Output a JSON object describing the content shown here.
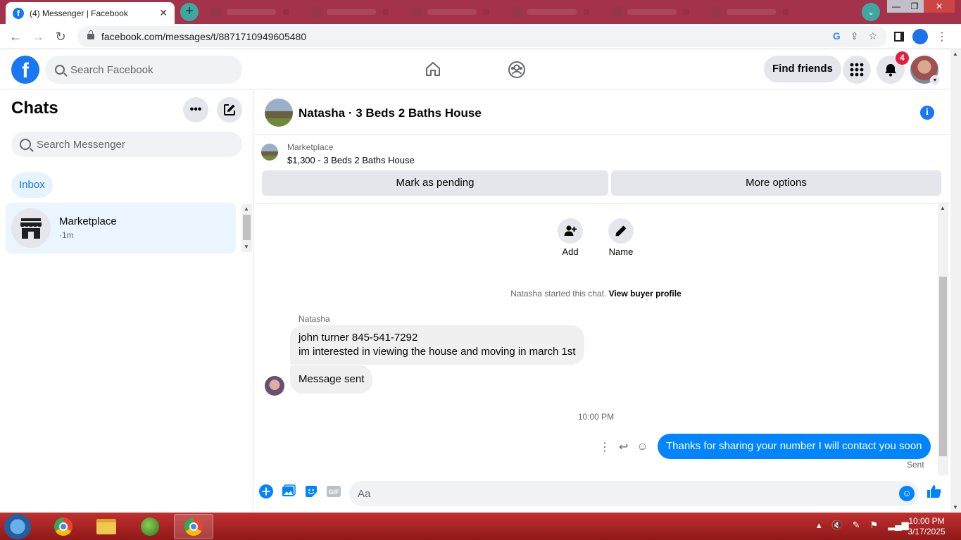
{
  "browser": {
    "tab_title": "(4) Messenger | Facebook",
    "url": "facebook.com/messages/t/8871710949605480"
  },
  "facebook": {
    "search_placeholder": "Search Facebook",
    "find_friends_label": "Find friends",
    "notification_count": "4"
  },
  "chats": {
    "title": "Chats",
    "search_placeholder": "Search Messenger",
    "inbox_label": "Inbox",
    "items": [
      {
        "name": "Marketplace",
        "time": "·1m"
      }
    ]
  },
  "conversation": {
    "title": "Natasha · 3 Beds 2 Baths House",
    "marketplace_label": "Marketplace",
    "listing": "$1,300 - 3 Beds 2 Baths House",
    "mark_pending_label": "Mark as pending",
    "more_options_label": "More options",
    "add_label": "Add",
    "name_label": "Name",
    "started_text": "Natasha started this chat.",
    "view_profile_label": "View buyer profile",
    "sender_name": "Natasha",
    "incoming_line1": "john turner 845-541-7292",
    "incoming_line2": "im interested in viewing the house and moving in march 1st",
    "incoming_2": "Message sent",
    "timestamp": "10:00 PM",
    "outgoing": "Thanks for sharing your number I will contact you soon",
    "sent_status": "Sent",
    "composer_placeholder": "Aa"
  },
  "taskbar": {
    "time": "10:00 PM",
    "date": "3/17/2025"
  },
  "colors": {
    "facebook_blue": "#1877f2",
    "messenger_blue": "#0084ff",
    "taskbar_red": "#a82020"
  }
}
